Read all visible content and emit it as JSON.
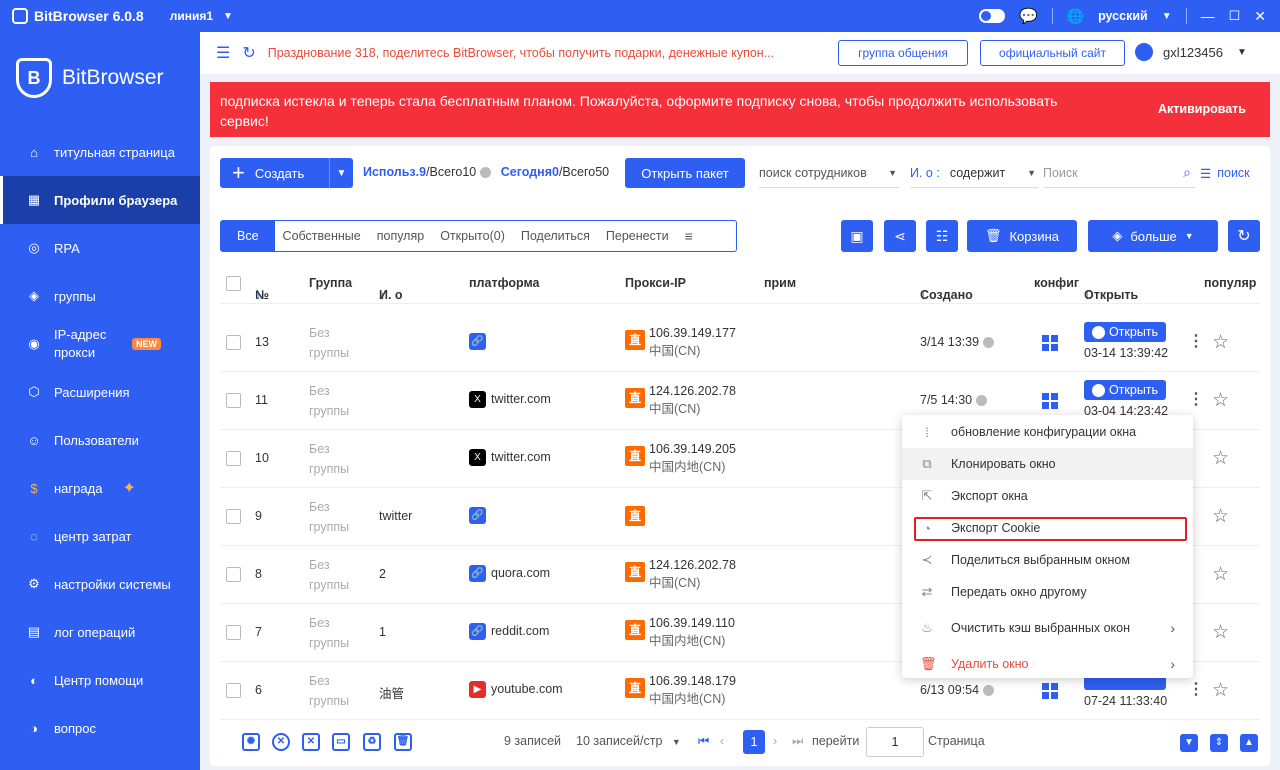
{
  "titlebar": {
    "app_name": "BitBrowser 6.0.8",
    "line": "линия1",
    "language": "русский"
  },
  "sidebar": {
    "brand": "BitBrowser",
    "new_badge": "NEW",
    "items": [
      {
        "label": "титульная страница",
        "icon": "home-icon"
      },
      {
        "label": "Профили браузера",
        "icon": "grid-icon",
        "active": true
      },
      {
        "label": "RPA",
        "icon": "rpa-icon"
      },
      {
        "label": "группы",
        "icon": "layers-icon"
      },
      {
        "label": "IP-адрес прокси",
        "icon": "location-icon"
      },
      {
        "label": "Расширения",
        "icon": "cube-icon"
      },
      {
        "label": "Пользователи",
        "icon": "users-icon"
      },
      {
        "label": "награда",
        "icon": "reward-icon"
      },
      {
        "label": "центр затрат",
        "icon": "cost-icon"
      },
      {
        "label": "настройки системы",
        "icon": "settings-icon"
      },
      {
        "label": "лог операций",
        "icon": "log-icon"
      },
      {
        "label": "Центр помощи",
        "icon": "help-icon"
      },
      {
        "label": "вопрос",
        "icon": "question-icon"
      }
    ]
  },
  "topbar": {
    "notice": "Празднование 318, поделитесь BitBrowser, чтобы получить подарки, денежные купон...",
    "group_btn": "группа общения",
    "site_btn": "официальный сайт",
    "username": "gxl123456"
  },
  "banner": {
    "message": "подписка истекла и теперь стала бесплатным планом. Пожалуйста, оформите подписку снова, чтобы продолжить использовать сервис!",
    "action": "Активировать"
  },
  "toolbar": {
    "create": "Создать",
    "used_label": "Использ.9",
    "used_total": "/Всего10",
    "today_label": "Сегодня0",
    "today_total": "/Всего50",
    "open_pkg": "Открыть пакет",
    "employee_search": "поиск сотрудников",
    "field_label": "И. о :",
    "contains": "содержит",
    "search_placeholder": "Поиск",
    "search_btn": "поиск"
  },
  "tabs": [
    "Все",
    "Собственные",
    "популяр",
    "Открыто(0)",
    "Поделиться",
    "Перенести"
  ],
  "actions": {
    "trash": "Корзина",
    "more": "больше"
  },
  "columns": [
    "№",
    "Группа",
    "И. о",
    "платформа",
    "Прокси-IP",
    "прим",
    "Создано",
    "конфиг",
    "Открыть",
    "популяр"
  ],
  "rows": [
    {
      "no": "13",
      "group1": "Без",
      "group2": "группы",
      "name": "",
      "platform": "",
      "picon": "link",
      "ip": "106.39.149.177",
      "loc": "中国(CN)",
      "created": "3/14 13:39",
      "open_label": "Открыть",
      "open_time": "03-14 13:39:42"
    },
    {
      "no": "11",
      "group1": "Без",
      "group2": "группы",
      "name": "",
      "platform": "twitter.com",
      "picon": "x",
      "ip": "124.126.202.78",
      "loc": "中国(CN)",
      "created": "7/5 14:30",
      "open_label": "Открыть",
      "open_time": "03-04 14:23:42"
    },
    {
      "no": "10",
      "group1": "Без",
      "group2": "группы",
      "name": "",
      "platform": "twitter.com",
      "picon": "x",
      "ip": "106.39.149.205",
      "loc": "中国内地(CN)",
      "created": "",
      "open_label": "",
      "open_time": ""
    },
    {
      "no": "9",
      "group1": "Без",
      "group2": "группы",
      "name": "twitter",
      "platform": "",
      "picon": "link",
      "ip": "",
      "loc": "",
      "created": "",
      "open_label": "",
      "open_time": ""
    },
    {
      "no": "8",
      "group1": "Без",
      "group2": "группы",
      "name": "2",
      "platform": "quora.com",
      "picon": "link",
      "ip": "124.126.202.78",
      "loc": "中国(CN)",
      "created": "",
      "open_label": "",
      "open_time": ""
    },
    {
      "no": "7",
      "group1": "Без",
      "group2": "группы",
      "name": "1",
      "platform": "reddit.com",
      "picon": "link",
      "ip": "106.39.149.110",
      "loc": "中国内地(CN)",
      "created": "",
      "open_label": "",
      "open_time": ""
    },
    {
      "no": "6",
      "group1": "Без",
      "group2": "группы",
      "name": "油管",
      "platform": "youtube.com",
      "picon": "yt",
      "ip": "106.39.148.179",
      "loc": "中国内地(CN)",
      "created": "6/13 09:54",
      "open_label": "",
      "open_time": "07-24 11:33:40"
    }
  ],
  "proxy_badge": "直",
  "pagination": {
    "total": "9 записей",
    "per_page": "10 записей/стр",
    "current": "1",
    "goto": "перейти",
    "page_input": "1",
    "page_word": "Страница"
  },
  "context_menu": [
    {
      "label": "обновление конфигурации окна",
      "icon": "config-icon"
    },
    {
      "label": "Клонировать окно",
      "icon": "clone-icon",
      "hover": true
    },
    {
      "label": "Экспорт окна",
      "icon": "export-icon"
    },
    {
      "label": "Экспорт Cookie",
      "icon": "cookie-icon",
      "highlight": true
    },
    {
      "label": "Поделиться выбранным окном",
      "icon": "share-icon"
    },
    {
      "label": "Передать окно другому",
      "icon": "transfer-icon"
    },
    {
      "label": "Очистить кэш выбранных окон",
      "icon": "broom-icon",
      "submenu": true
    },
    {
      "label": "Удалить окно",
      "icon": "trash-icon",
      "danger": true,
      "submenu": true
    }
  ],
  "colors": {
    "primary": "#2e5ff2",
    "sidebar_active": "#1a3fa8",
    "banner": "#f4313a",
    "danger": "#e74c3c",
    "proxy": "#ff6a00",
    "highlight_border": "#e02020"
  }
}
